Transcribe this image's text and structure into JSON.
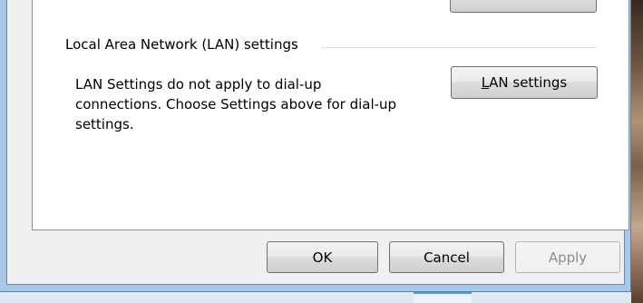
{
  "lan_section": {
    "title": "Local Area Network (LAN) settings",
    "description_lines": [
      "LAN Settings do not apply to dial-up",
      "connections. Choose Settings above for dial-up",
      "settings."
    ],
    "lan_button": {
      "mnemonic": "L",
      "rest": "AN settings"
    }
  },
  "footer": {
    "ok_label": "OK",
    "cancel_label": "Cancel",
    "apply_label": "Apply"
  },
  "colors": {
    "dialog_bg": "#f0f0f0",
    "panel_bg": "#ffffff",
    "frame": "#a9c7e6"
  }
}
